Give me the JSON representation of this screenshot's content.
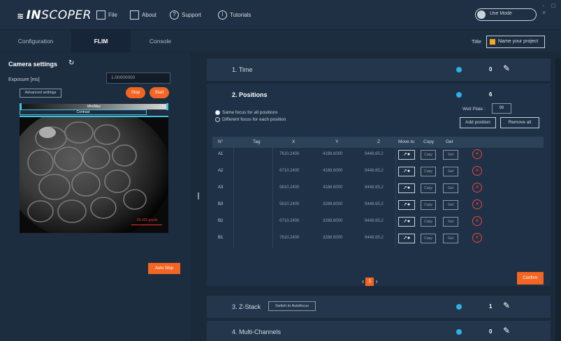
{
  "app": {
    "logo": "INSCOPER",
    "menu": [
      {
        "label": "File",
        "icon": "file-icon"
      },
      {
        "label": "About",
        "icon": "about-icon"
      },
      {
        "label": "Support",
        "icon": "support-icon"
      },
      {
        "label": "Tutorials",
        "icon": "info-icon"
      }
    ],
    "use_mode": "Use Mode",
    "window_controls": "- □ ×"
  },
  "tabs": [
    {
      "label": "Configuration"
    },
    {
      "label": "FLIM"
    },
    {
      "label": "Console"
    }
  ],
  "title_field": {
    "label": "Title",
    "placeholder": "Name your project",
    "accent": "#f5a623"
  },
  "left": {
    "camera_title": "Camera settings",
    "exposure_label": "Exposure [ms]",
    "exposure_value": "1.00000000",
    "advanced_button": "Advanced settings",
    "stop_button": "Stop",
    "start_button": "Start",
    "slider_label": "Min/Max",
    "contrast_label": "Contrast",
    "scale_label": "50.425 pixels",
    "auto_stop_button": "Auto Stop"
  },
  "sections": [
    {
      "title": "1. Time",
      "count": "0"
    },
    {
      "title": "2. Positions",
      "count": "6"
    },
    {
      "title": "3. Z-Stack",
      "count": "1",
      "button": "Switch to Autofocus"
    },
    {
      "title": "4. Multi-Channels",
      "count": "0"
    }
  ],
  "positions": {
    "radio_same": "Same focus for all positions",
    "radio_diff": "Different focus for each position",
    "well_plate_label": "Well Plate :",
    "well_plate_value": "96",
    "add_button": "Add position",
    "remove_button": "Remove all",
    "columns": [
      "N°",
      "Tag",
      "X",
      "Y",
      "Z",
      "Move to",
      "Copy",
      "Get"
    ],
    "rows": [
      {
        "name": "A1",
        "tag": "",
        "x": "7610.2400",
        "y": "4188.6000",
        "z": "9448.65.2"
      },
      {
        "name": "A2",
        "tag": "",
        "x": "6710.2400",
        "y": "4188.6000",
        "z": "9448.65.2"
      },
      {
        "name": "A3",
        "tag": "",
        "x": "5810.2400",
        "y": "4188.6000",
        "z": "9448.65.2"
      },
      {
        "name": "B3",
        "tag": "",
        "x": "5810.2400",
        "y": "3288.6000",
        "z": "9448.65.2"
      },
      {
        "name": "B2",
        "tag": "",
        "x": "6710.2400",
        "y": "3288.6000",
        "z": "9448.65.2"
      },
      {
        "name": "B1",
        "tag": "",
        "x": "7610.2400",
        "y": "3288.6000",
        "z": "9448.65.2"
      }
    ],
    "copy_label": "Copy",
    "get_label": "Get",
    "move_label": "➚●",
    "page": "1",
    "confirm_button": "Confirm"
  }
}
